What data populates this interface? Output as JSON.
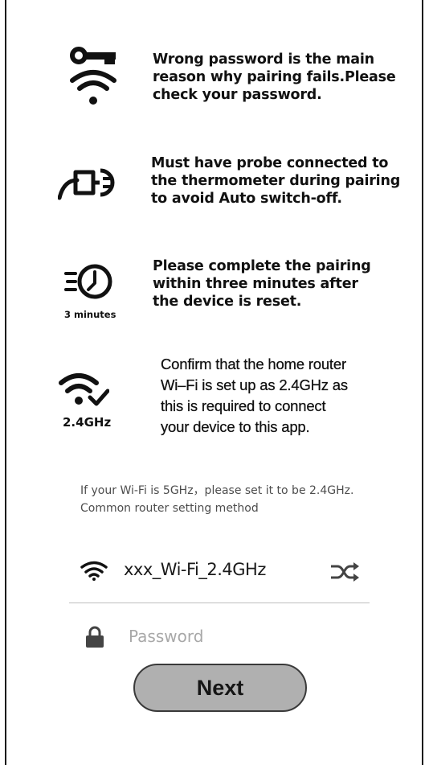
{
  "tips": [
    {
      "icon": "key-wifi-icon",
      "lines": [
        "Wrong password is the main",
        "reason why pairing fails.Please",
        "check your password."
      ]
    },
    {
      "icon": "probe-plug-icon",
      "lines": [
        "Must have probe connected to",
        "the thermometer during pairing",
        "to avoid Auto switch-off."
      ]
    },
    {
      "icon": "timer-icon",
      "caption": "3 minutes",
      "lines": [
        "Please complete the pairing",
        "within three minutes after",
        "the device is reset."
      ]
    },
    {
      "icon": "wifi-check-icon",
      "caption": "2.4GHz",
      "lines": [
        "Confirm that the home router",
        "Wi–Fi is set up as 2.4GHz as",
        "this is required to connect",
        "your device to this app."
      ]
    }
  ],
  "note": {
    "prefix": "If your Wi-Fi is 5GHz，please set it to be 2.4GHz.",
    "link": "Common router setting method"
  },
  "wifi": {
    "ssid": "xxx_Wi-Fi_2.4GHz",
    "icon": "wifi-icon",
    "switch_icon": "shuffle-icon"
  },
  "password": {
    "placeholder": "Password",
    "value": "",
    "icon": "lock-icon"
  },
  "next_label": "Next"
}
